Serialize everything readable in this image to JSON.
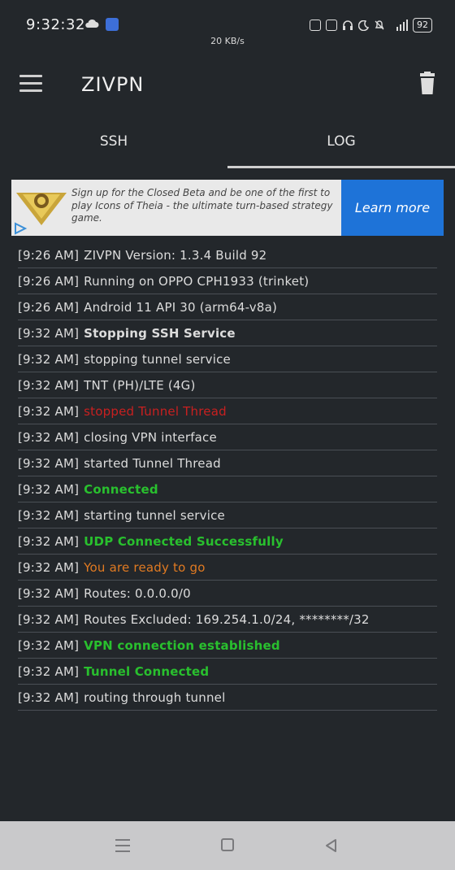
{
  "status_bar": {
    "time": "9:32:32",
    "net_speed": "20 KB/s",
    "battery": "92"
  },
  "app_bar": {
    "title": "ZIVPN"
  },
  "tabs": [
    {
      "label": "SSH",
      "selected": false
    },
    {
      "label": "LOG",
      "selected": true
    }
  ],
  "ad": {
    "text": "Sign up for the Closed Beta and be one of the first to play Icons of Theia - the ultimate turn-based strategy game.",
    "cta": "Learn more"
  },
  "colors": {
    "background": "#23272b",
    "error": "#c82020",
    "success": "#29c02e",
    "warning": "#e07a22",
    "ad_cta": "#1e73d8"
  },
  "log": [
    {
      "time": "[9:26 AM]",
      "message": "ZIVPN Version: 1.3.4 Build 92",
      "style": "normal"
    },
    {
      "time": "[9:26 AM]",
      "message": "Running on OPPO CPH1933 (trinket)",
      "style": "normal"
    },
    {
      "time": "[9:26 AM]",
      "message": "Android 11 API 30 (arm64-v8a)",
      "style": "normal"
    },
    {
      "time": "[9:32 AM]",
      "message": "Stopping SSH Service",
      "style": "bold"
    },
    {
      "time": "[9:32 AM]",
      "message": "stopping tunnel service",
      "style": "normal"
    },
    {
      "time": "[9:32 AM]",
      "message": "TNT (PH)/LTE (4G)",
      "style": "normal"
    },
    {
      "time": "[9:32 AM]",
      "message": "stopped Tunnel Thread",
      "style": "red"
    },
    {
      "time": "[9:32 AM]",
      "message": "closing VPN interface",
      "style": "normal"
    },
    {
      "time": "[9:32 AM]",
      "message": "started Tunnel Thread",
      "style": "normal"
    },
    {
      "time": "[9:32 AM]",
      "message": "Connected",
      "style": "green"
    },
    {
      "time": "[9:32 AM]",
      "message": "starting tunnel service",
      "style": "normal"
    },
    {
      "time": "[9:32 AM]",
      "message": "UDP Connected Successfully",
      "style": "green"
    },
    {
      "time": "[9:32 AM]",
      "message": "You are ready to go",
      "style": "orange"
    },
    {
      "time": "[9:32 AM]",
      "message": "Routes: 0.0.0.0/0",
      "style": "normal"
    },
    {
      "time": "[9:32 AM]",
      "message": "Routes Excluded: 169.254.1.0/24, ********/32",
      "style": "normal"
    },
    {
      "time": "[9:32 AM]",
      "message": "VPN connection established",
      "style": "green"
    },
    {
      "time": "[9:32 AM]",
      "message": "Tunnel Connected",
      "style": "green"
    },
    {
      "time": "[9:32 AM]",
      "message": "routing through tunnel",
      "style": "normal"
    }
  ],
  "icons": {
    "menu": "hamburger-icon",
    "delete": "trash-icon",
    "nav_recent": "recent-apps-icon",
    "nav_home": "home-icon",
    "nav_back": "back-icon"
  }
}
